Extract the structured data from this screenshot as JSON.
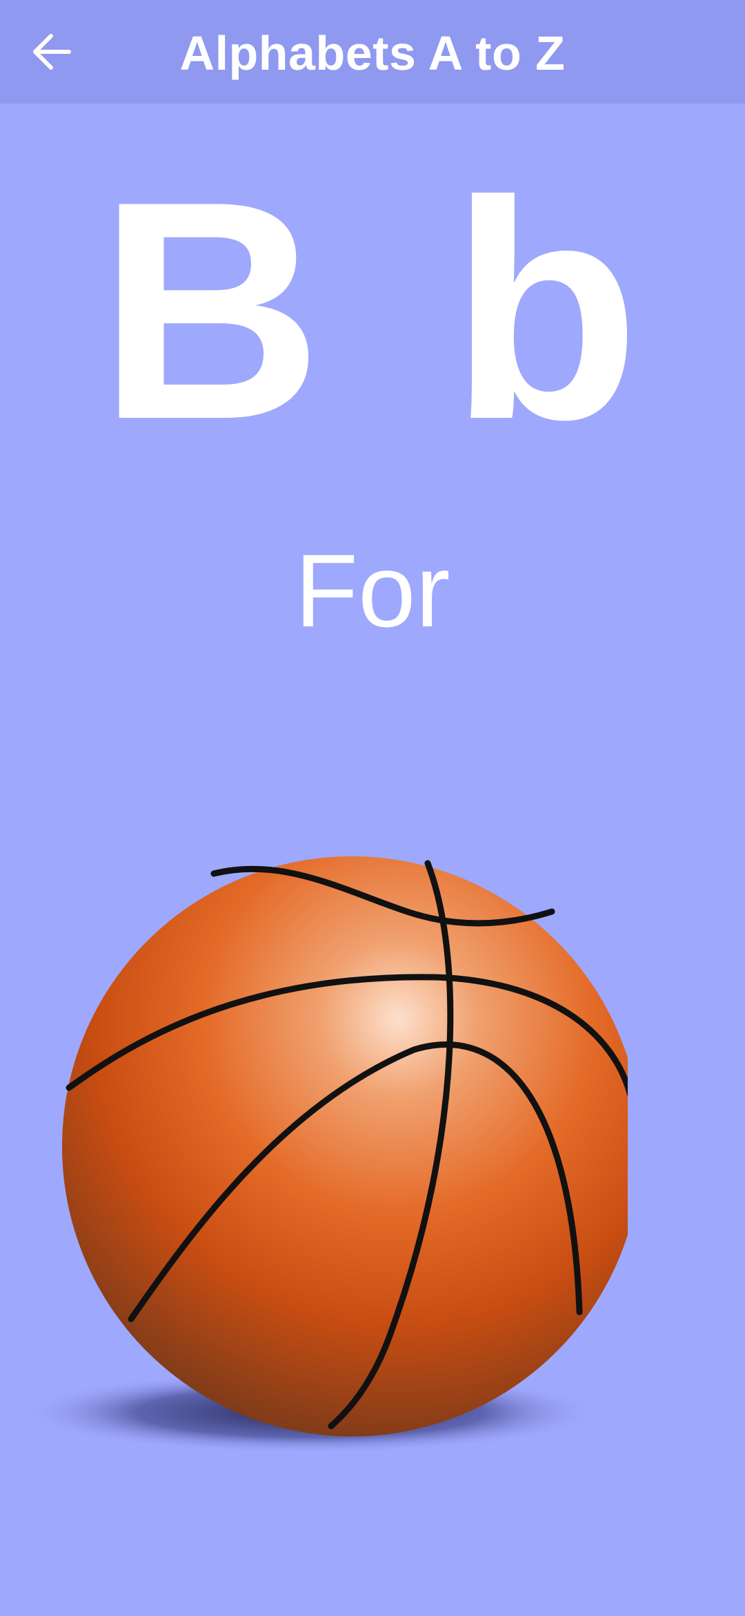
{
  "app_bar": {
    "back_icon": "arrow-left-icon",
    "title": "Alphabets A to Z"
  },
  "card": {
    "letters": "B b",
    "connector": "For",
    "image_icon": "basketball-illustration"
  },
  "colors": {
    "background": "#9ea8fd",
    "app_bar": "#8f99ef",
    "text": "#ffffff",
    "ball_orange": "#e06a2a"
  }
}
